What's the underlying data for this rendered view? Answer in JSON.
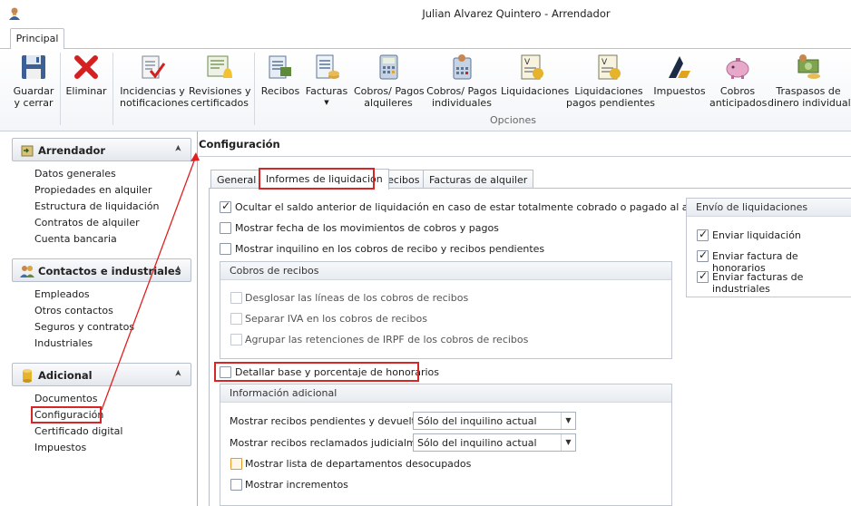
{
  "window": {
    "title": "Julian Alvarez Quintero - Arrendador"
  },
  "ribbon": {
    "tab": "Principal",
    "group_label": "Opciones",
    "buttons": {
      "guardar": "Guardar\ny cerrar",
      "eliminar": "Eliminar",
      "incidencias": "Incidencias y\nnotificaciones",
      "revisiones": "Revisiones y\ncertificados",
      "recibos": "Recibos",
      "facturas": "Facturas",
      "cobros_alquileres": "Cobros/ Pagos\nalquileres",
      "cobros_individuales": "Cobros/ Pagos\nindividuales",
      "liquidaciones": "Liquidaciones",
      "liq_pendientes": "Liquidaciones\npagos pendientes",
      "impuestos": "Impuestos",
      "cobros_anticipados": "Cobros\nanticipados",
      "traspasos": "Traspasos de\ndinero individual"
    }
  },
  "sidebar": {
    "arrendador": {
      "title": "Arrendador",
      "items": [
        "Datos generales",
        "Propiedades en alquiler",
        "Estructura de liquidación",
        "Contratos de alquiler",
        "Cuenta bancaria"
      ]
    },
    "contactos": {
      "title": "Contactos e industriales",
      "items": [
        "Empleados",
        "Otros contactos",
        "Seguros y contratos",
        "Industriales"
      ]
    },
    "adicional": {
      "title": "Adicional",
      "items": [
        "Documentos",
        "Configuración",
        "Certificado digital",
        "Impuestos"
      ]
    }
  },
  "content": {
    "title": "Configuración",
    "tabs": [
      "General",
      "Informes de liquidación",
      "Recibos",
      "Facturas de alquiler"
    ],
    "options": {
      "ocultar_saldo": "Ocultar el saldo anterior de liquidación en caso de estar totalmente cobrado o pagado al arrendador",
      "mostrar_fecha": "Mostrar fecha de los movimientos de cobros y pagos",
      "mostrar_inquilino": "Mostrar inquilino en los cobros de recibo y recibos pendientes",
      "detallar_base": "Detallar base y porcentaje de honorarios"
    },
    "cobros_recibos": {
      "title": "Cobros de recibos",
      "items": [
        "Desglosar las líneas de los cobros de recibos",
        "Separar IVA en los cobros de recibos",
        "Agrupar las retenciones de IRPF de los cobros de recibos"
      ]
    },
    "envio": {
      "title": "Envío de liquidaciones",
      "items": [
        "Enviar liquidación",
        "Enviar factura de honorarios",
        "Enviar facturas de industriales"
      ]
    },
    "info_adicional": {
      "title": "Información adicional",
      "pendientes_label": "Mostrar recibos pendientes y devueltos:",
      "pendientes_value": "Sólo del inquilino actual",
      "reclamados_label": "Mostrar recibos reclamados judicialmente:",
      "reclamados_value": "Sólo del inquilino actual",
      "departamentos": "Mostrar lista de departamentos desocupados",
      "incrementos": "Mostrar incrementos"
    }
  }
}
